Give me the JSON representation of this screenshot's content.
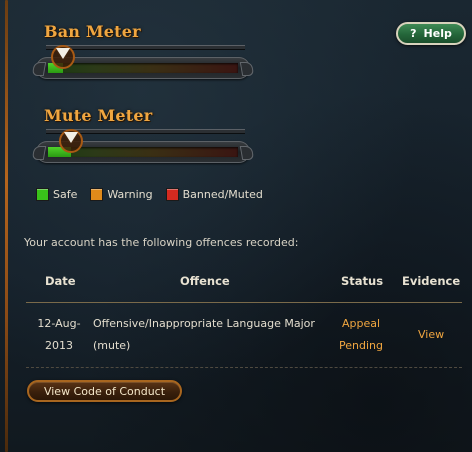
{
  "help_button": {
    "label": "Help",
    "icon": "question-mark-icon",
    "glyph": "?"
  },
  "ban_meter": {
    "title": "Ban Meter",
    "level": 0.08
  },
  "mute_meter": {
    "title": "Mute Meter",
    "level": 0.12
  },
  "legend": [
    {
      "label": "Safe",
      "color": "#39c21a"
    },
    {
      "label": "Warning",
      "color": "#e08a1a"
    },
    {
      "label": "Banned/Muted",
      "color": "#d42a20"
    }
  ],
  "offences": {
    "intro": "Your account has the following offences recorded:",
    "headers": {
      "date": "Date",
      "offence": "Offence",
      "status": "Status",
      "evidence": "Evidence"
    },
    "rows": [
      {
        "date_line1": "12-Aug-",
        "date_line2": "2013",
        "offence_line1": "Offensive/Inappropriate Language Major",
        "offence_line2": "(mute)",
        "status_line1": "Appeal",
        "status_line2": "Pending",
        "evidence": "View"
      }
    ]
  },
  "code_of_conduct_button": {
    "label": "View Code of Conduct"
  },
  "colors": {
    "accent": "#f0a640",
    "help_green": "#2f7a45",
    "panel_bg": "#16212a"
  }
}
